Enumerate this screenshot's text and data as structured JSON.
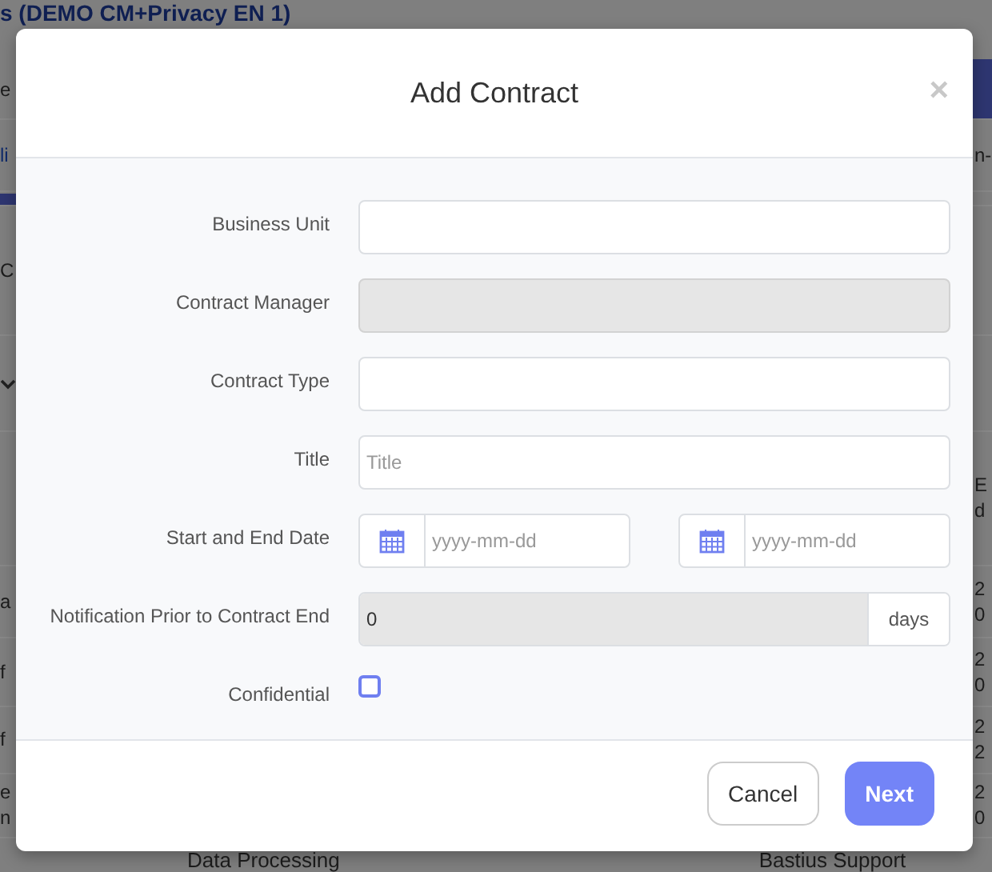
{
  "background": {
    "page_title": "s (DEMO CM+Privacy EN 1)",
    "rows": [
      {
        "kind": "text",
        "left": "e",
        "right_bar": true
      },
      {
        "kind": "link",
        "left": "li",
        "right": "n-"
      },
      {
        "kind": "bar"
      },
      {
        "kind": "text",
        "left": "C"
      },
      {
        "kind": "chevron"
      },
      {
        "kind": "text",
        "right": "E\nd"
      },
      {
        "kind": "text",
        "left": "a",
        "right": "2\n0"
      },
      {
        "kind": "text",
        "left": "f",
        "right": "2\n0"
      },
      {
        "kind": "text",
        "left": "f",
        "right": "2\n2"
      },
      {
        "kind": "text",
        "left": "e\nn",
        "right": "2\n0"
      }
    ],
    "bottom_cells": [
      "Data Processing",
      "Bastius Support"
    ]
  },
  "modal": {
    "title": "Add Contract",
    "close": "×",
    "fields": [
      {
        "kind": "text",
        "label": "Business Unit",
        "disabled": false
      },
      {
        "kind": "text",
        "label": "Contract Manager",
        "disabled": true
      },
      {
        "kind": "text",
        "label": "Contract Type",
        "disabled": false
      },
      {
        "kind": "text",
        "label": "Title",
        "placeholder": "Title",
        "disabled": false
      },
      {
        "kind": "daterange",
        "label": "Start and End Date",
        "placeholders": [
          "yyyy-mm-dd",
          "yyyy-mm-dd"
        ]
      },
      {
        "kind": "number",
        "label": "Notification Prior to Contract End",
        "value": "0",
        "unit": "days",
        "disabled": true
      },
      {
        "kind": "checkbox",
        "label": "Confidential",
        "checked": false
      }
    ],
    "buttons": [
      {
        "label": "Cancel",
        "kind": "secondary"
      },
      {
        "label": "Next",
        "kind": "primary"
      }
    ]
  }
}
